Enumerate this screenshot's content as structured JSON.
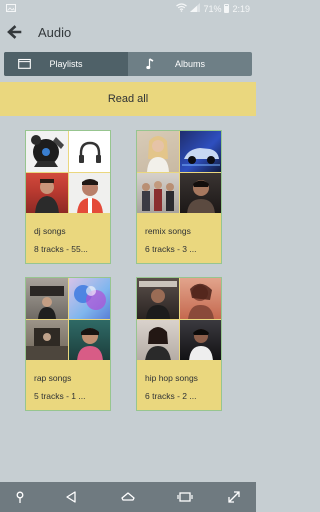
{
  "status_bar": {
    "notification_icon": "image-icon",
    "battery": "71%",
    "time": "2:19"
  },
  "app_bar": {
    "title": "Audio",
    "back_icon": "arrow-left-icon"
  },
  "tabs": [
    {
      "label": "Playlists",
      "icon": "folder-icon",
      "active": true
    },
    {
      "label": "Albums",
      "icon": "music-note-icon",
      "active": false
    }
  ],
  "read_all": {
    "label": "Read all"
  },
  "playlists": [
    {
      "name": "dj songs",
      "tracks": "8 tracks - 55..."
    },
    {
      "name": "remix songs",
      "tracks": "6 tracks - 3 ..."
    },
    {
      "name": "rap songs",
      "tracks": "5 tracks - 1 ..."
    },
    {
      "name": "hip hop songs",
      "tracks": "6 tracks - 2 ..."
    }
  ],
  "nav_bar": {
    "items": [
      "pin-icon",
      "back-triangle-icon",
      "home-icon",
      "recents-icon",
      "expand-icon"
    ]
  },
  "colors": {
    "background": "#c6ced2",
    "tab_bar": "#6e7f86",
    "tab_active": "#4f6168",
    "accent_yellow": "#ead77e",
    "card_border": "#97c58f",
    "nav_bar": "#6f7a80"
  }
}
